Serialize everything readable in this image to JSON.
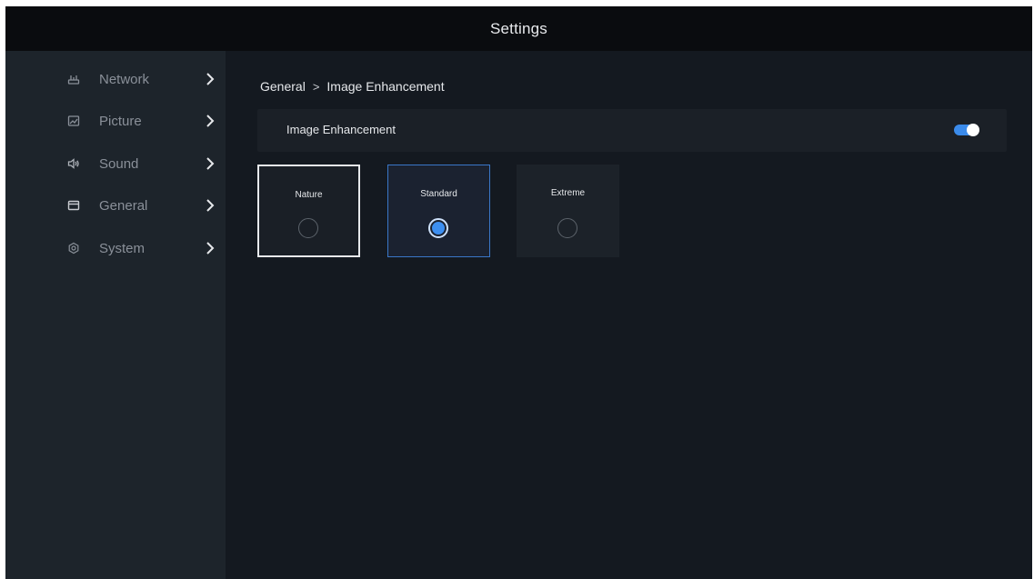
{
  "header": {
    "title": "Settings"
  },
  "sidebar": {
    "items": [
      {
        "label": "Network",
        "icon": "network-icon"
      },
      {
        "label": "Picture",
        "icon": "picture-icon"
      },
      {
        "label": "Sound",
        "icon": "sound-icon"
      },
      {
        "label": "General",
        "icon": "general-icon"
      },
      {
        "label": "System",
        "icon": "system-icon"
      }
    ]
  },
  "main": {
    "breadcrumb": {
      "parent": "General",
      "separator": ">",
      "current": "Image Enhancement"
    },
    "toggle_row": {
      "label": "Image Enhancement",
      "enabled": true
    },
    "options": [
      {
        "label": "Nature",
        "selected": false,
        "focused": true
      },
      {
        "label": "Standard",
        "selected": true,
        "focused": false
      },
      {
        "label": "Extreme",
        "selected": false,
        "focused": false
      }
    ]
  },
  "colors": {
    "accent": "#3b8beb",
    "background": "#141920",
    "sidebar": "#1d242b",
    "titlebar": "#0a0c0f"
  }
}
